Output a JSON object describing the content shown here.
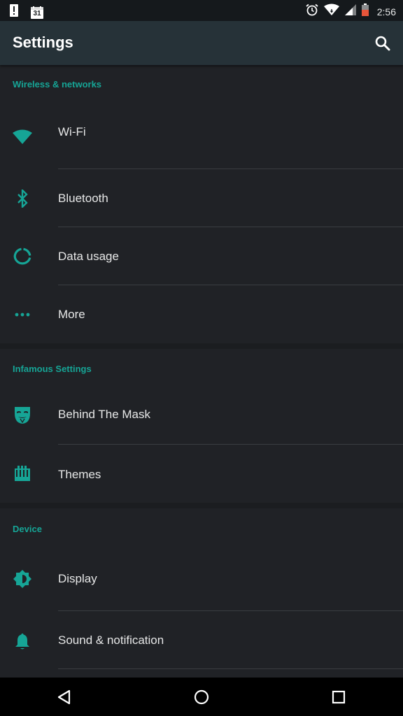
{
  "status_bar": {
    "time": "2:56",
    "calendar_day": "31",
    "left_icons": [
      "alert-icon",
      "calendar-icon"
    ],
    "right_icons": [
      "alarm-icon",
      "wifi-icon",
      "signal-icon",
      "battery-icon"
    ]
  },
  "app_bar": {
    "title": "Settings",
    "search_icon": "search-icon"
  },
  "sections": [
    {
      "header": "Wireless & networks",
      "items": [
        {
          "label": "Wi-Fi",
          "icon": "wifi-icon"
        },
        {
          "label": "Bluetooth",
          "icon": "bluetooth-icon"
        },
        {
          "label": "Data usage",
          "icon": "data-usage-icon"
        },
        {
          "label": "More",
          "icon": "more-dots-icon"
        }
      ]
    },
    {
      "header": "Infamous Settings",
      "items": [
        {
          "label": "Behind The Mask",
          "icon": "mask-icon"
        },
        {
          "label": "Themes",
          "icon": "themes-icon"
        }
      ]
    },
    {
      "header": "Device",
      "items": [
        {
          "label": "Display",
          "icon": "display-brightness-icon"
        },
        {
          "label": "Sound & notification",
          "icon": "bell-icon"
        }
      ]
    }
  ],
  "nav_bar": {
    "back_icon": "back-icon",
    "home_icon": "home-icon",
    "recents_icon": "recents-icon"
  },
  "colors": {
    "accent": "#16a596",
    "background": "#202226",
    "app_bar": "#263238",
    "status_bar": "#15191c"
  }
}
